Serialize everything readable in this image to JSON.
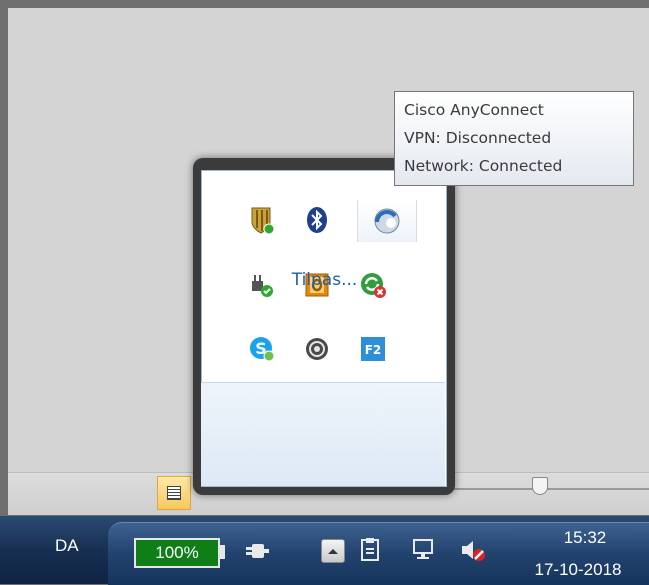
{
  "tooltip": {
    "lines": [
      "Cisco AnyConnect",
      "VPN: Disconnected",
      "Network: Connected"
    ]
  },
  "flyout": {
    "customize_label": "Tilpas...",
    "icons": [
      "antivirus-shield-icon",
      "bluetooth-icon",
      "cisco-anyconnect-icon",
      "power-plug-icon",
      "office-upload-icon",
      "sync-error-icon",
      "skype-icon",
      "gray-spiral-icon",
      "f2-icon"
    ],
    "f2_label": "F2"
  },
  "taskbar": {
    "language": "DA",
    "battery": "100%",
    "time": "15:32",
    "date": "17-10-2018"
  },
  "colors": {
    "battery_green": "#0f7e19",
    "link_blue": "#1f5ea8"
  }
}
